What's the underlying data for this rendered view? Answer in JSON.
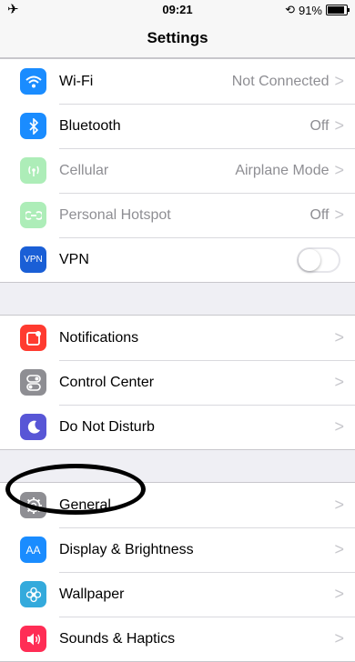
{
  "status": {
    "time": "09:21",
    "battery": "91%",
    "airplane_icon": "✈",
    "lock_icon": "⟲"
  },
  "nav": {
    "title": "Settings"
  },
  "groups": [
    [
      {
        "label": "Wi-Fi",
        "value": "Not Connected",
        "icon": "wifi",
        "color": "#1a8cff"
      },
      {
        "label": "Bluetooth",
        "value": "Off",
        "icon": "bluetooth",
        "color": "#1a8cff"
      },
      {
        "label": "Cellular",
        "value": "Airplane Mode",
        "icon": "cellular",
        "color": "#4cd964"
      },
      {
        "label": "Personal Hotspot",
        "value": "Off",
        "icon": "hotspot",
        "color": "#4cd964"
      },
      {
        "label": "VPN",
        "value": "",
        "icon": "vpn",
        "icon_text": "VPN",
        "color": "#1a5fd6",
        "toggle": "off"
      }
    ],
    [
      {
        "label": "Notifications",
        "icon": "notifications",
        "color": "#ff3b30"
      },
      {
        "label": "Control Center",
        "icon": "control-center",
        "color": "#8e8e93"
      },
      {
        "label": "Do Not Disturb",
        "icon": "do-not-disturb",
        "color": "#5856d6"
      }
    ],
    [
      {
        "label": "General",
        "icon": "general",
        "color": "#8e8e93"
      },
      {
        "label": "Display & Brightness",
        "icon": "display",
        "icon_text": "AA",
        "color": "#1a8cff"
      },
      {
        "label": "Wallpaper",
        "icon": "wallpaper",
        "color": "#34aadc"
      },
      {
        "label": "Sounds & Haptics",
        "icon": "sounds",
        "color": "#ff2d55"
      }
    ]
  ],
  "chevron": ">"
}
